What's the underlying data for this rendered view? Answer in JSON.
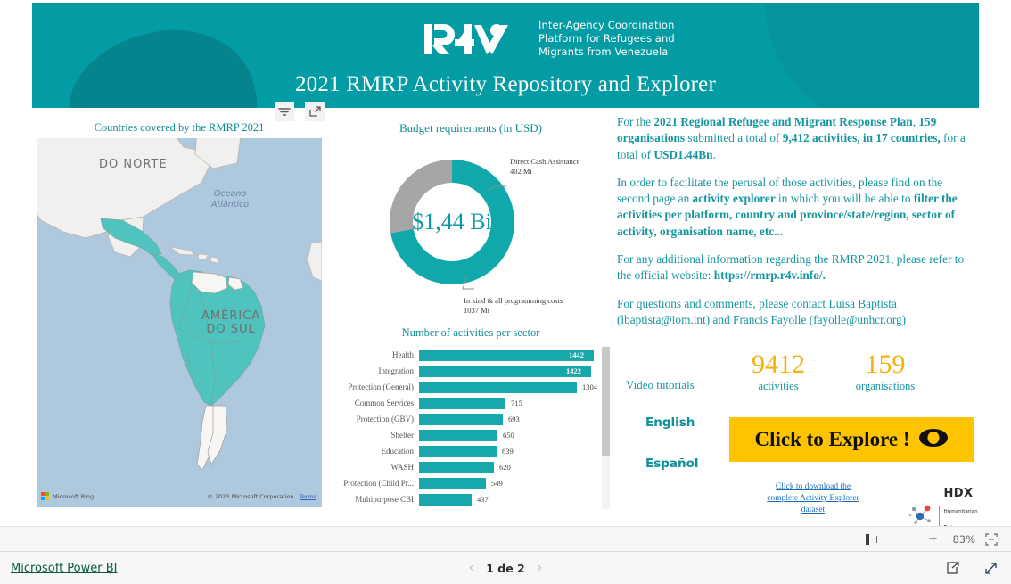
{
  "banner": {
    "logo_name": "r4v-logo",
    "tagline": "Inter-Agency Coordination\nPlatform for Refugees and\nMigrants from Venezuela",
    "title": "2021 RMRP Activity Repository and Explorer",
    "bg_color": "#039ba4"
  },
  "viz_header": {
    "filter_icon": "filter-icon",
    "focus_icon": "focus-mode-icon"
  },
  "map": {
    "title": "Countries covered by the RMRP 2021",
    "north_america_label": "DO NORTE",
    "south_america_label": "AMÉRICA\nDO SUL",
    "ocean_label": "Oceano\nAtlântico",
    "provider": "Microsoft Bing",
    "copyright": "© 2023 Microsoft Corporation",
    "terms": "Terms",
    "highlight_color": "#4fc3bd"
  },
  "donut": {
    "title": "Budget requirements (in USD)",
    "center_value": "$1,44 Bi",
    "callout_top": "Direct Cash Assistance\n402 Mi",
    "callout_bottom": "In kind & all programming costs\n1037 Mi"
  },
  "bars": {
    "title": "Number of activities per sector"
  },
  "chart_data": [
    {
      "type": "pie",
      "title": "Budget requirements (in USD)",
      "labels": [
        "In kind & all programming costs",
        "Direct Cash Assistance"
      ],
      "values": [
        1037,
        402
      ],
      "unit": "Mi USD",
      "colors": [
        "#11a8ab",
        "#a6a6a6"
      ],
      "center_label": "$1,44 Bi",
      "legend": "callout-labels"
    },
    {
      "type": "bar",
      "title": "Number of activities per sector",
      "orientation": "horizontal",
      "categories": [
        "Health",
        "Integration",
        "Protection (General)",
        "Common Services",
        "Protection (GBV)",
        "Shelter",
        "Education",
        "WASH",
        "Protection (Child Pr...",
        "Multipurpose CBI"
      ],
      "values": [
        1442,
        1422,
        1304,
        715,
        693,
        650,
        639,
        620,
        549,
        437
      ],
      "xlabel": "",
      "ylabel": "",
      "xlim": [
        0,
        1442
      ],
      "grid": false,
      "bar_color": "#17a8ab",
      "scrollable": true
    }
  ],
  "description": {
    "p1_a": "For the ",
    "p1_b1": "2021 Regional Refugee and Migrant Response Plan",
    "p1_c": ", ",
    "p1_b2": "159 organisations",
    "p1_d": " submitted a total of ",
    "p1_b3": "9,412 activities, in 17 countries,",
    "p1_e": " for a total of ",
    "p1_b4": "USD1.44Bn",
    "p1_f": ".",
    "p2_a": "In order to facilitate the perusal of those activities, please find on the second page an ",
    "p2_b1": "activity explorer",
    "p2_c": " in which you will be able to ",
    "p2_b2": "filter the activities per platform, country and province/state/region, sector of activity, organisation name, etc...",
    "p3_a": "For any additional information regarding the RMRP 2021, please refer to the official website: ",
    "p3_b1": "https://rmrp.r4v.info/.",
    "p4_a": "For questions and comments, please contact Luisa Baptista (lbaptista@iom.int) and Francis Fayolle (fayolle@unhcr.org)"
  },
  "kpis": {
    "video_tutorials_label": "Video tutorials",
    "language_english": "English",
    "language_spanish": "Español",
    "activities_value": "9412",
    "activities_caption": "activities",
    "organisations_value": "159",
    "organisations_caption": "organisations",
    "accent_color": "#f5b10c"
  },
  "explore": {
    "label": "Click to Explore !",
    "icon": "eye-icon",
    "bg_color": "#ffc400"
  },
  "download": {
    "link_text": "Click to download the\ncomplete Activity Explorer\ndataset",
    "hdx_title": "HDX",
    "hdx_subtitle": "Humanitarian\nData Exchange",
    "hdx_icon": "hdx-network-icon"
  },
  "zoombar": {
    "minus": "-",
    "plus": "+",
    "percent": "83%",
    "fit_icon": "fit-to-page-icon"
  },
  "statusbar": {
    "brand": "Microsoft Power BI",
    "prev_icon": "chevron-left-icon",
    "page_label": "1 de 2",
    "next_icon": "chevron-right-icon",
    "share_icon": "share-icon",
    "fullscreen_icon": "fullscreen-icon"
  }
}
